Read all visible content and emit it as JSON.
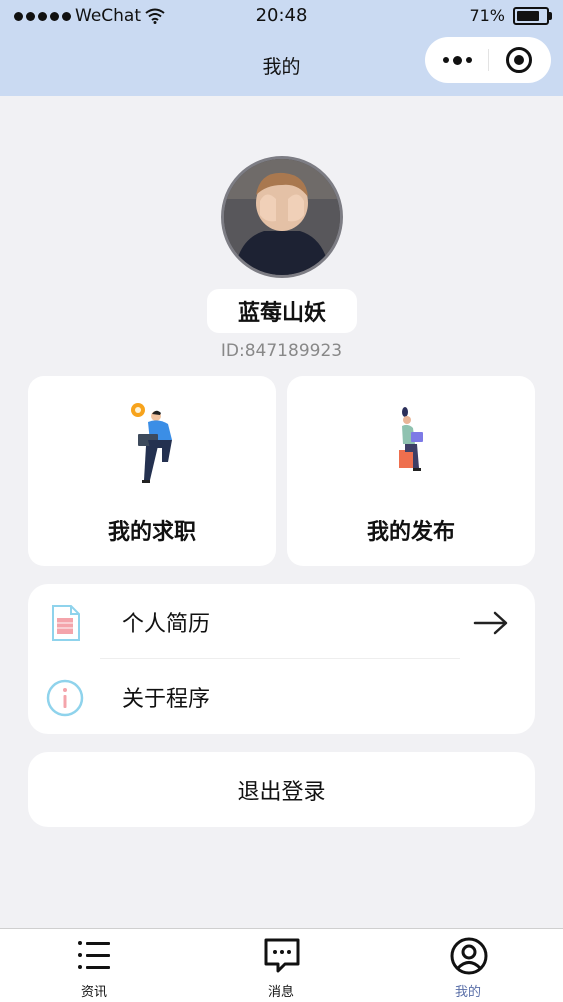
{
  "status": {
    "carrier": "WeChat",
    "time": "20:48",
    "battery": "71%"
  },
  "nav": {
    "title": "我的"
  },
  "profile": {
    "name": "蓝莓山妖",
    "id": "ID:847189923"
  },
  "cards": {
    "jobs": "我的求职",
    "posts": "我的发布"
  },
  "menu": {
    "resume": "个人简历",
    "about": "关于程序"
  },
  "logout": "退出登录",
  "tabs": {
    "news": "资讯",
    "messages": "消息",
    "mine": "我的"
  },
  "colors": {
    "nav_bg": "#cadaf2",
    "page_bg": "#f1f1f4",
    "active_tab": "#5a6fa8"
  }
}
